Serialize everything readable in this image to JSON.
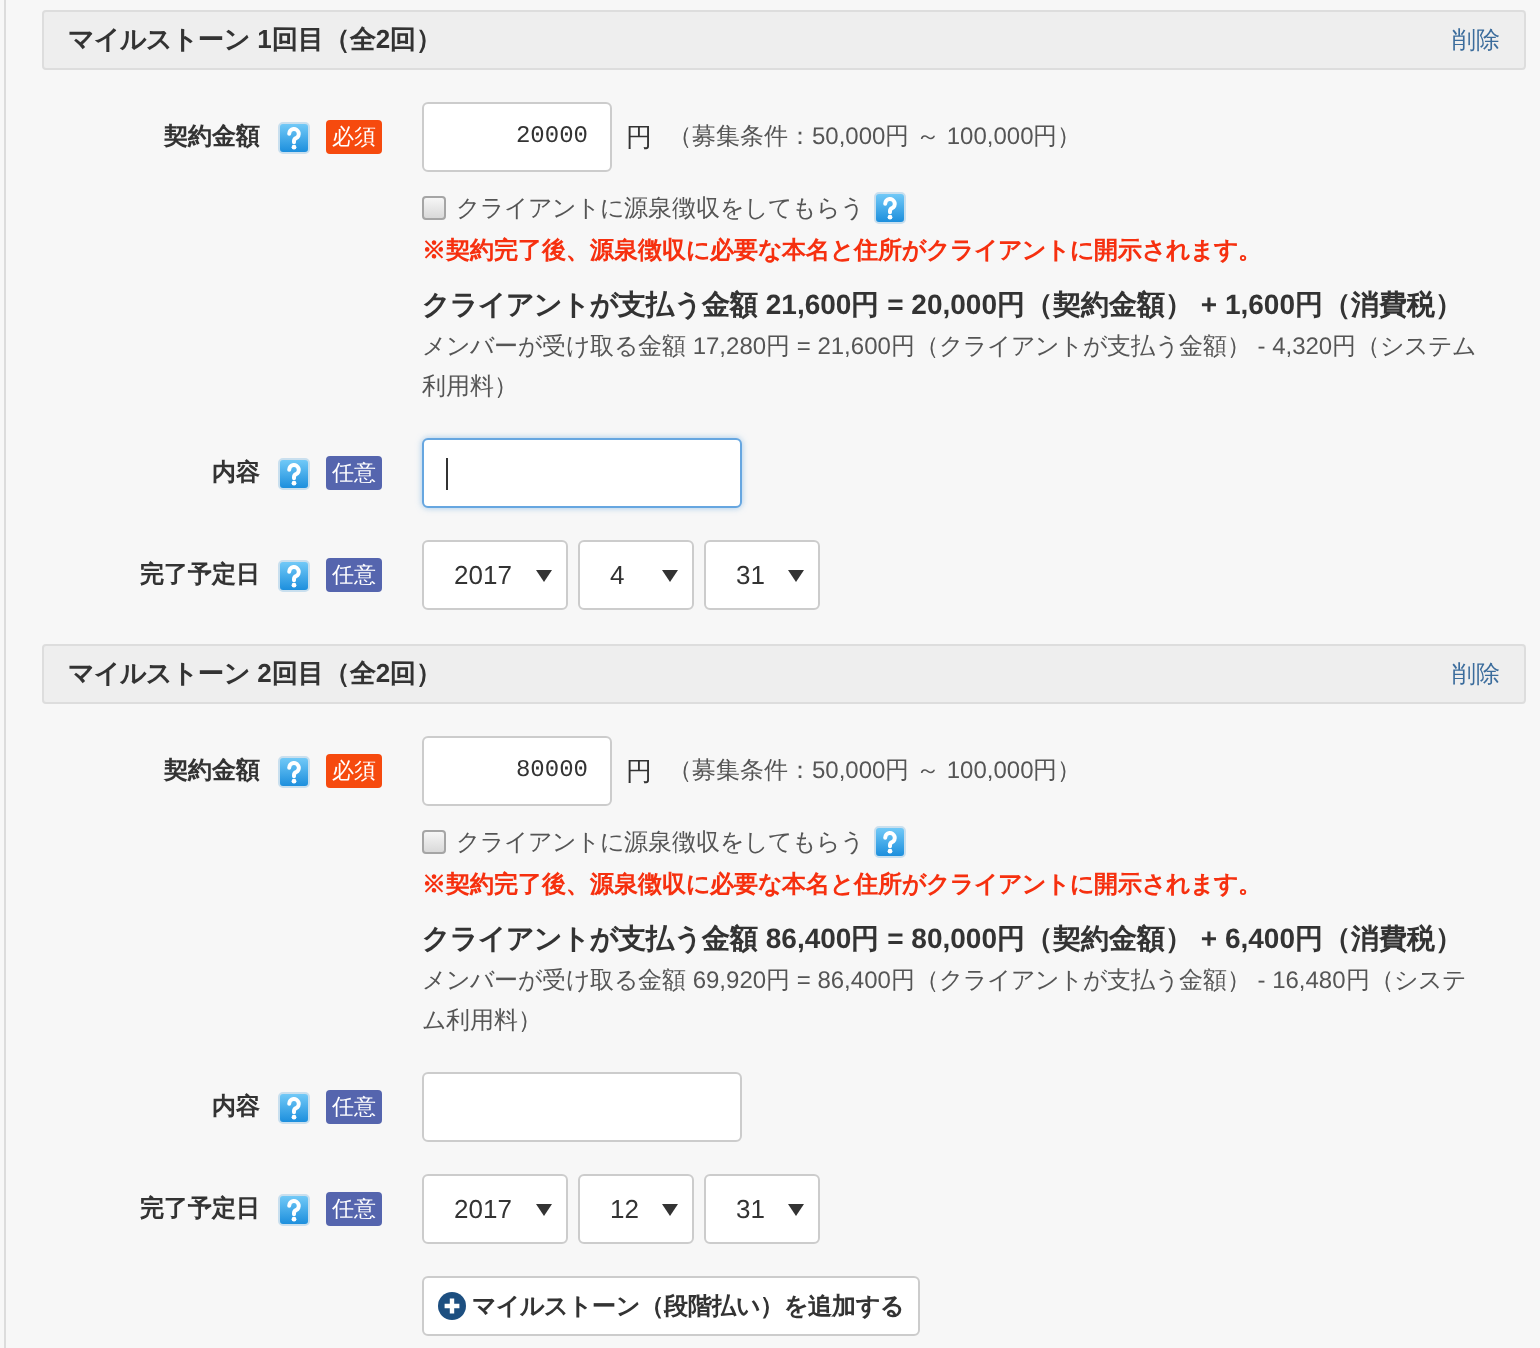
{
  "milestones": [
    {
      "title": "マイルストーン 1回目（全2回）",
      "delete_link": "削除",
      "amount": {
        "label": "契約金額",
        "badge": {
          "text": "必須",
          "kind": "required"
        },
        "value": "20000",
        "unit": "円",
        "condition": "（募集条件：50,000円 ～ 100,000円）"
      },
      "withholding": {
        "label": "クライアントに源泉徴収をしてもらう",
        "checked": false
      },
      "warning": "※契約完了後、源泉徴収に必要な本名と住所がクライアントに開示されます。",
      "client_payment": "クライアントが支払う金額 21,600円 = 20,000円（契約金額） + 1,600円（消費税）",
      "member_receipt": "メンバーが受け取る金額 17,280円 = 21,600円（クライアントが支払う金額） - 4,320円（システム利用料）",
      "content": {
        "label": "内容",
        "badge": {
          "text": "任意",
          "kind": "optional"
        },
        "focused": true
      },
      "due_date": {
        "label": "完了予定日",
        "badge": {
          "text": "任意",
          "kind": "optional"
        },
        "year": "2017",
        "month": "4",
        "day": "31"
      }
    },
    {
      "title": "マイルストーン 2回目（全2回）",
      "delete_link": "削除",
      "amount": {
        "label": "契約金額",
        "badge": {
          "text": "必須",
          "kind": "required"
        },
        "value": "80000",
        "unit": "円",
        "condition": "（募集条件：50,000円 ～ 100,000円）"
      },
      "withholding": {
        "label": "クライアントに源泉徴収をしてもらう",
        "checked": false
      },
      "warning": "※契約完了後、源泉徴収に必要な本名と住所がクライアントに開示されます。",
      "client_payment": "クライアントが支払う金額 86,400円 = 80,000円（契約金額） + 6,400円（消費税）",
      "member_receipt": "メンバーが受け取る金額 69,920円 = 86,400円（クライアントが支払う金額） - 16,480円（システム利用料）",
      "content": {
        "label": "内容",
        "badge": {
          "text": "任意",
          "kind": "optional"
        },
        "focused": false
      },
      "due_date": {
        "label": "完了予定日",
        "badge": {
          "text": "任意",
          "kind": "optional"
        },
        "year": "2017",
        "month": "12",
        "day": "31"
      }
    }
  ],
  "add_button": {
    "label": "マイルストーン（段階払い）を追加する"
  }
}
